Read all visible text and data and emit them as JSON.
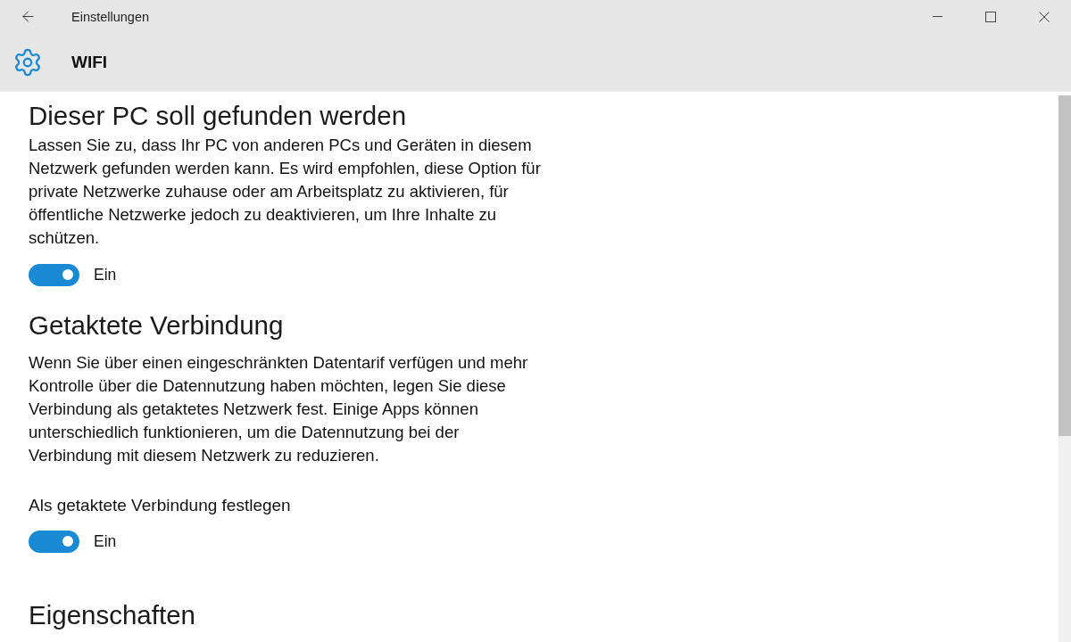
{
  "window": {
    "title": "Einstellungen"
  },
  "header": {
    "title": "WIFI"
  },
  "sections": [
    {
      "heading": "Dieser PC soll gefunden werden",
      "description": "Lassen Sie zu, dass Ihr PC von anderen PCs und Geräten in diesem Netzwerk gefunden werden kann. Es wird empfohlen, diese Option für private Netzwerke zuhause oder am Arbeitsplatz zu aktivieren, für öffentliche Netzwerke jedoch zu deaktivieren, um Ihre Inhalte zu schützen.",
      "settings": [
        {
          "kind": "toggle",
          "on": true,
          "state_label": "Ein"
        }
      ]
    },
    {
      "heading": "Getaktete Verbindung",
      "description": "Wenn Sie über einen eingeschränkten Datentarif verfügen und mehr Kontrolle über die Datennutzung haben möchten, legen Sie diese Verbindung als getaktetes Netzwerk fest. Einige Apps können unterschiedlich funktionieren, um die Datennutzung bei der Verbindung mit diesem Netzwerk zu reduzieren.",
      "settings": [
        {
          "kind": "toggle",
          "label": "Als getaktete Verbindung festlegen",
          "on": true,
          "state_label": "Ein"
        }
      ]
    },
    {
      "heading": "Eigenschaften"
    }
  ]
}
